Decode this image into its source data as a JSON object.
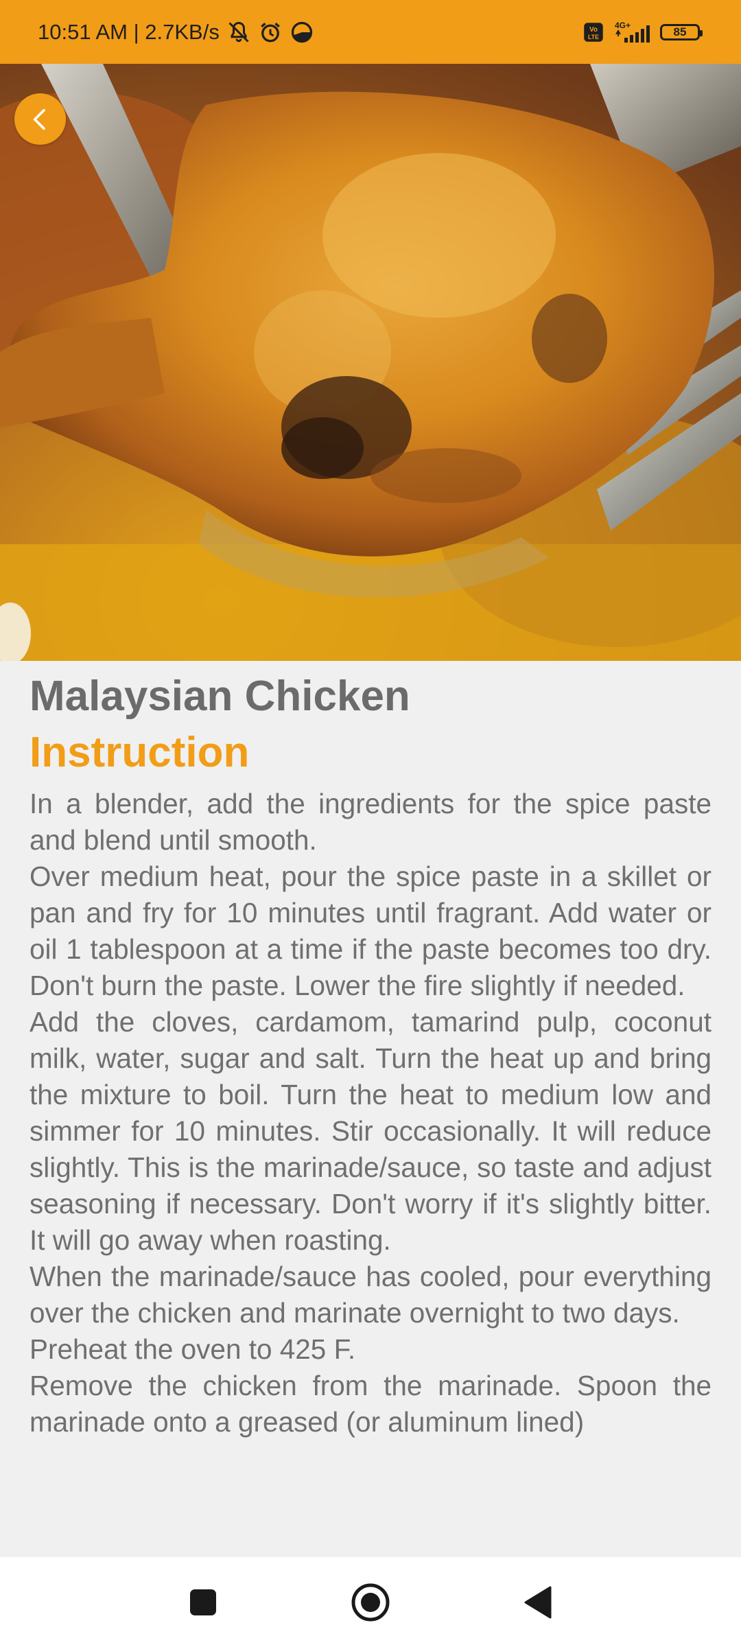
{
  "status_bar": {
    "time_speed": "10:51 AM | 2.7KB/s",
    "network_type": "4G+",
    "volte": "Vo LTE",
    "battery": "85",
    "icons": [
      "mute-bell-icon",
      "alarm-icon",
      "data-saver-icon",
      "volte-icon",
      "signal-icon",
      "battery-icon"
    ]
  },
  "hero": {
    "image": "fried-chicken-photo"
  },
  "recipe": {
    "title": "Malaysian Chicken",
    "section_heading": "Instruction",
    "steps": [
      "In a blender, add the ingredients for the spice paste and blend until smooth.",
      "Over medium heat, pour the spice paste in a skillet or pan and fry for 10 minutes until fragrant. Add water or oil 1 tablespoon at a time if the paste becomes too dry. Don't burn the paste. Lower the fire slightly if needed.",
      "Add the cloves, cardamom, tamarind pulp, coconut milk, water, sugar and salt. Turn the heat up and bring the mixture to boil. Turn the heat to medium low and simmer for 10 minutes. Stir occasionally. It will reduce slightly. This is the marinade/sauce, so taste and adjust seasoning if necessary. Don't worry if it's slightly bitter. It will go away when roasting.",
      "When the marinade/sauce has cooled, pour everything over the chicken and marinate overnight to two days.",
      "Preheat the oven to 425 F.",
      "Remove the chicken from the marinade. Spoon the marinade onto a greased (or aluminum lined)"
    ]
  },
  "colors": {
    "accent": "#f19d17",
    "title_text": "#6b6b6b",
    "body_text": "#6f6f6f",
    "background": "#f0f0f0"
  },
  "nav_bar": {
    "icons": [
      "recents-square-icon",
      "home-circle-icon",
      "back-triangle-icon"
    ]
  }
}
